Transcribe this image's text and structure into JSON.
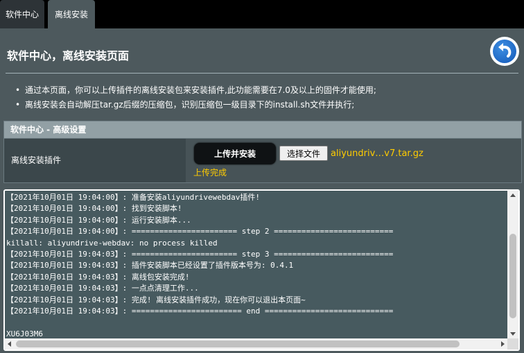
{
  "tabs": [
    {
      "label": "软件中心"
    },
    {
      "label": "离线安装"
    }
  ],
  "header": {
    "title": "软件中心，离线安装页面",
    "back_icon": "back-arrow-icon"
  },
  "notes": [
    "通过本页面，你可以上传插件的离线安装包来安装插件,此功能需要在7.0及以上的固件才能使用;",
    "离线安装会自动解压tar.gz后缀的压缩包，识别压缩包一级目录下的install.sh文件并执行;"
  ],
  "settings": {
    "header": "软件中心 - 高级设置",
    "row_label": "离线安装插件",
    "upload_button": "上传并安装",
    "file_button": "选择文件",
    "file_name": "aliyundriv…v7.tar.gz",
    "status": "上传完成"
  },
  "log": {
    "lines": [
      "【2021年10月01日 19:04:00】: 准备安装aliyundrivewebdav插件!",
      "【2021年10月01日 19:04:00】: 找到安装脚本!",
      "【2021年10月01日 19:04:00】: 运行安装脚本...",
      "【2021年10月01日 19:04:00】: ======================= step 2 ==========================",
      "killall: aliyundrive-webdav: no process killed",
      "【2021年10月01日 19:04:03】: ======================= step 3 ==========================",
      "【2021年10月01日 19:04:03】: 插件安装脚本已经设置了插件版本号为: 0.4.1",
      "【2021年10月01日 19:04:03】: 离线包安装完成!",
      "【2021年10月01日 19:04:03】: 一点点清理工作...",
      "【2021年10月01日 19:04:03】: 完成! 离线安装插件成功，现在你可以退出本页面~",
      "【2021年10月01日 19:04:03】: ======================== end ============================",
      "",
      "XU6J03M6"
    ]
  },
  "colors": {
    "background": "#4d595d",
    "accent_yellow": "#ffcc00",
    "tab_active": "#4d595d"
  }
}
